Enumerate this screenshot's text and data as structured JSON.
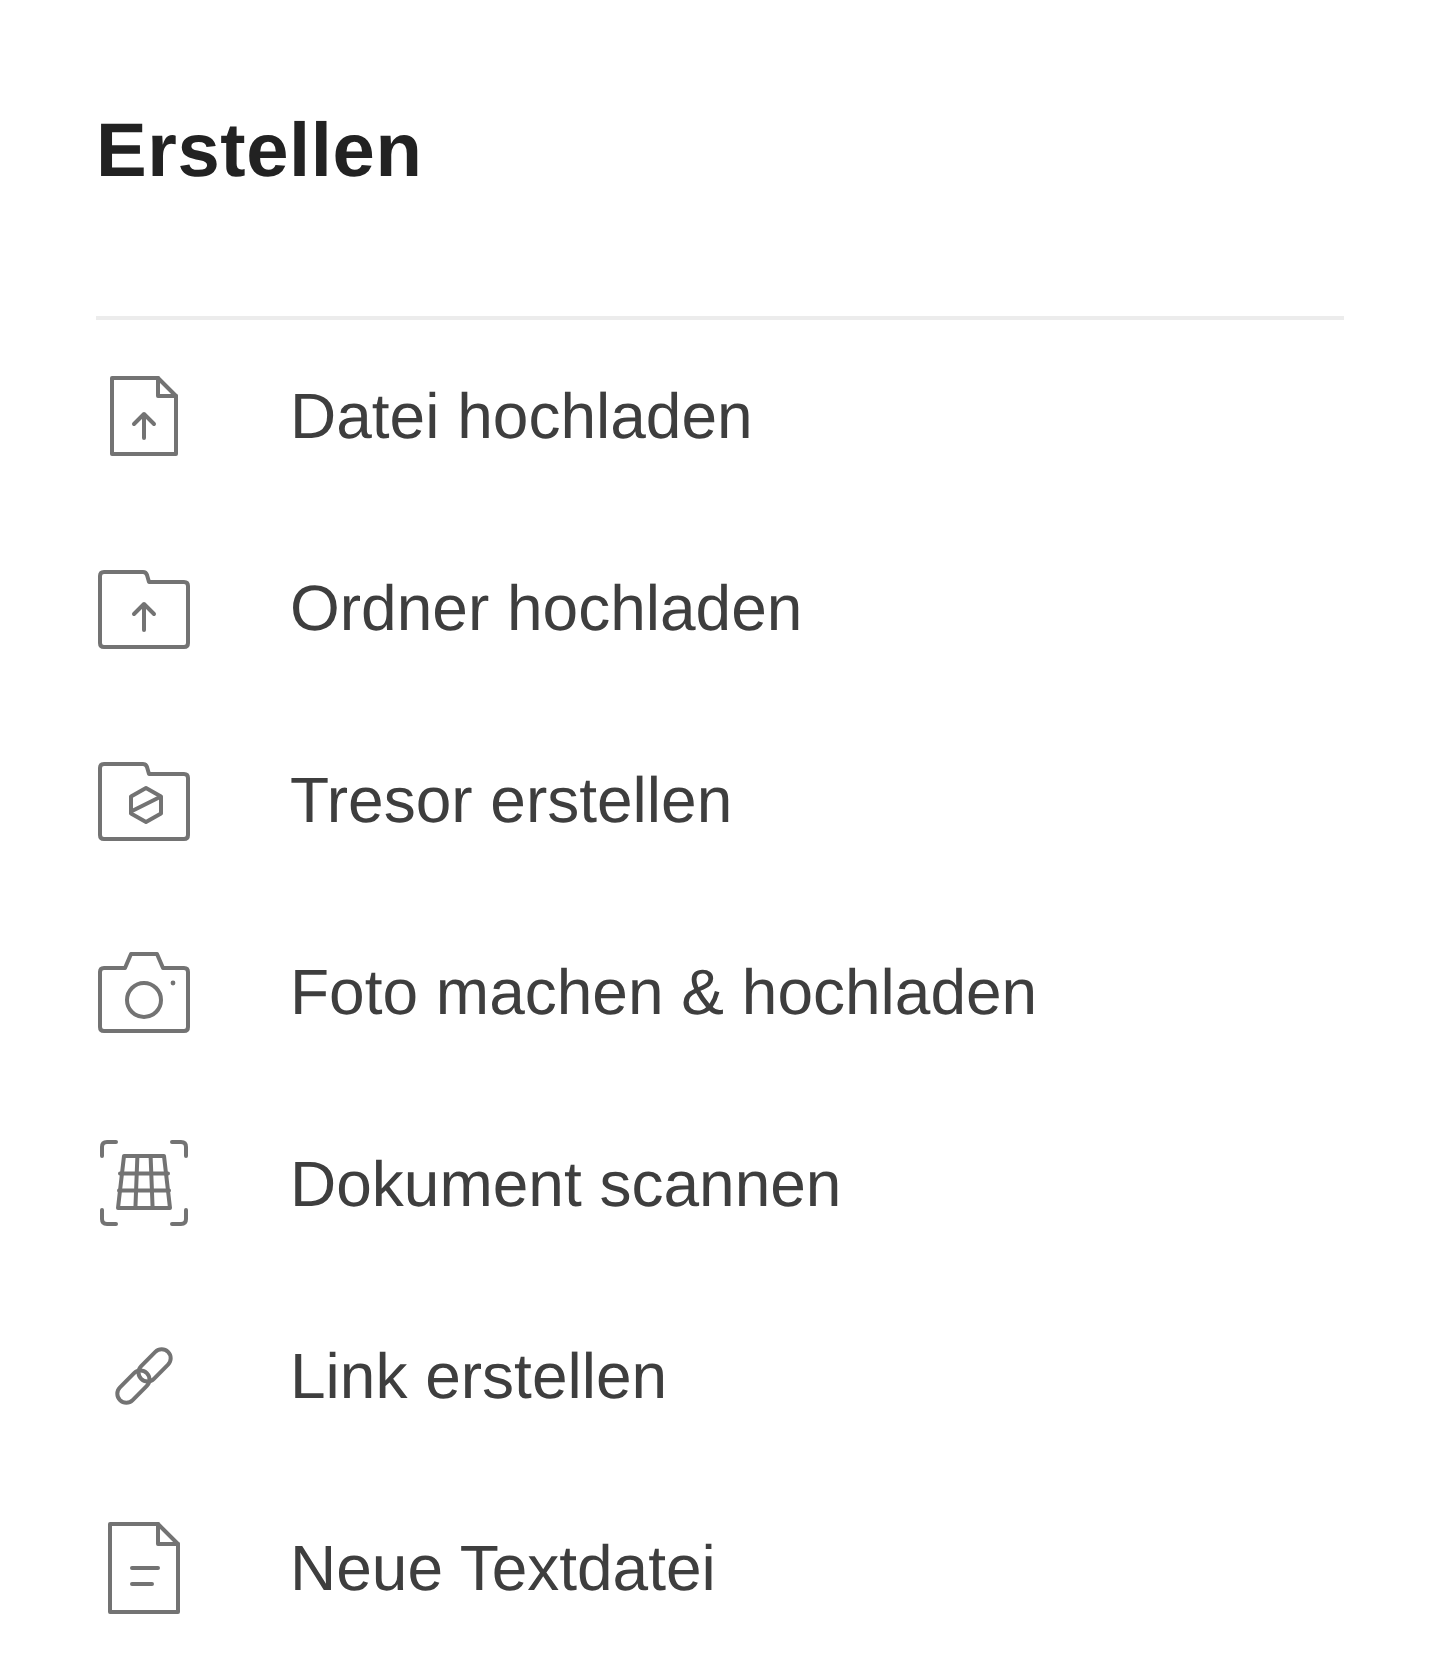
{
  "title": "Erstellen",
  "items": [
    {
      "kind": "file-upload",
      "label": "Datei hochladen"
    },
    {
      "kind": "folder-upload",
      "label": "Ordner hochladen"
    },
    {
      "kind": "vault",
      "label": "Tresor erstellen"
    },
    {
      "kind": "camera",
      "label": "Foto machen & hochladen"
    },
    {
      "kind": "scan",
      "label": "Dokument scannen"
    },
    {
      "kind": "link",
      "label": "Link erstellen"
    },
    {
      "kind": "text-file",
      "label": "Neue Textdatei"
    }
  ]
}
